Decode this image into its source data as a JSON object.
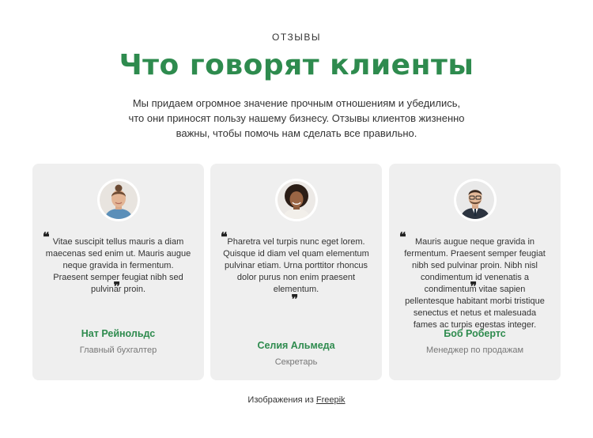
{
  "section": {
    "eyebrow": "ОТЗЫВЫ",
    "title": "Что говорят клиенты",
    "intro": "Мы придаем огромное значение прочным отношениям и убедились, что они приносят пользу нашему бизнесу. Отзывы клиентов жизненно важны, чтобы помочь нам сделать все правильно."
  },
  "testimonials": [
    {
      "quote_open": "❝",
      "text": "Vitae suscipit tellus mauris a diam maecenas sed enim ut. Mauris augue neque gravida in fermentum. Praesent semper feugiat nibh sed pulvinar proin.",
      "quote_close": "❞",
      "name": "Нат Рейнольдс",
      "role": "Главный бухгалтер"
    },
    {
      "quote_open": "❝",
      "text": "Pharetra vel turpis nunc eget lorem. Quisque id diam vel quam elementum pulvinar etiam. Urna porttitor rhoncus dolor purus non enim praesent elementum.",
      "quote_close": "❞",
      "name": "Селия Альмеда",
      "role": "Секретарь"
    },
    {
      "quote_open": "❝",
      "text": "Mauris augue neque gravida in fermentum. Praesent semper feugiat nibh sed pulvinar proin. Nibh nisl condimentum id venenatis a condimentum vitae sapien pellentesque habitant morbi tristique senectus et netus et malesuada fames ac turpis egestas integer.",
      "quote_close": "❞",
      "name": "Боб Робертс",
      "role": "Менеджер по продажам"
    }
  ],
  "credit": {
    "prefix": "Изображения из",
    "link": "Freepik"
  },
  "colors": {
    "accent": "#2e8b4e",
    "card_bg": "#efefef"
  }
}
